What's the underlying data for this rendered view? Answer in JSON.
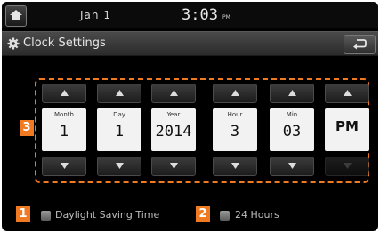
{
  "status_bar": {
    "date": "Jan  1",
    "time": "3:03",
    "ampm": "PM"
  },
  "header": {
    "title": "Clock Settings"
  },
  "picker": {
    "columns": [
      {
        "label": "Month",
        "value": "1"
      },
      {
        "label": "Day",
        "value": "1"
      },
      {
        "label": "Year",
        "value": "2014"
      },
      {
        "label": "Hour",
        "value": "3"
      },
      {
        "label": "Min",
        "value": "03"
      },
      {
        "label": "",
        "value": "PM"
      }
    ]
  },
  "badges": {
    "picker": "3",
    "daylight": "1",
    "hours24": "2"
  },
  "options": {
    "daylight_saving": {
      "label": "Daylight Saving Time",
      "checked": false
    },
    "hours_24": {
      "label": "24 Hours",
      "checked": false
    }
  },
  "colors": {
    "accent": "#f07a22",
    "background": "#000000",
    "field": "#f2f2f2"
  },
  "icons": {
    "home": "home-icon",
    "settings": "gear-icon",
    "back": "back-arrow-icon",
    "up": "chevron-up-icon",
    "down": "chevron-down-icon"
  }
}
